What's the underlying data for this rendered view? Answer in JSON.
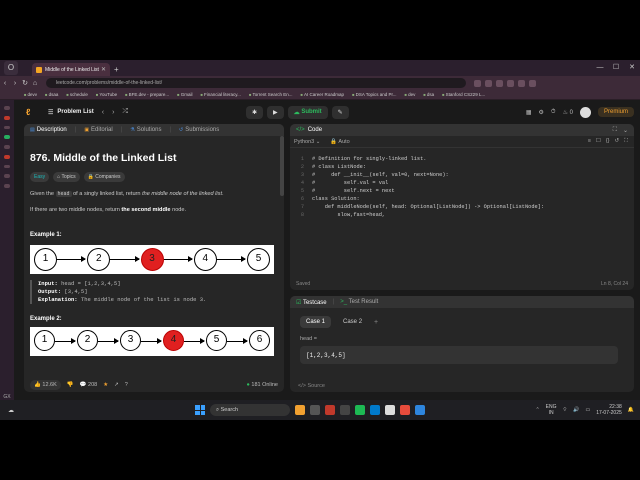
{
  "browser": {
    "tab_title": "Middle of the Linked List",
    "url": "leetcode.com/problems/middle-of-the-linked-list/",
    "bookmarks": [
      "devv",
      "dsaa",
      "schedule",
      "YouTube",
      "BFE.dev - prepare...",
      "Gmail",
      "Financial literacy...",
      "Torrent Search En...",
      "AI Career Roadmap",
      "DSA Topics and Pr...",
      "dev",
      "dsa",
      "Stanford CS229 L..."
    ]
  },
  "lc_header": {
    "problem_list": "Problem List",
    "submit": "Submit",
    "streak": "0",
    "premium": "Premium"
  },
  "problem": {
    "tabs": {
      "description": "Description",
      "editorial": "Editorial",
      "solutions": "Solutions",
      "submissions": "Submissions"
    },
    "title": "876. Middle of the Linked List",
    "difficulty": "Easy",
    "topics": "Topics",
    "companies": "Companies",
    "desc1_a": "Given the ",
    "desc1_code": "head",
    "desc1_b": " of a singly linked list, return ",
    "desc1_em": "the middle node of the linked list",
    "desc1_c": ".",
    "desc2_a": "If there are two middle nodes, return ",
    "desc2_b": "the second middle",
    "desc2_c": " node.",
    "example1": {
      "title": "Example 1:",
      "nodes": [
        "1",
        "2",
        "3",
        "4",
        "5"
      ],
      "input_label": "Input:",
      "input": "head = [1,2,3,4,5]",
      "output_label": "Output:",
      "output": "[3,4,5]",
      "explanation_label": "Explanation:",
      "explanation": "The middle node of the list is node 3."
    },
    "example2": {
      "title": "Example 2:",
      "nodes": [
        "1",
        "2",
        "3",
        "4",
        "5",
        "6"
      ]
    },
    "footer": {
      "likes": "12.6K",
      "comments": "208",
      "online": "181 Online"
    }
  },
  "code": {
    "title": "Code",
    "language": "Python3",
    "mode": "Auto",
    "lines": [
      "# Definition for singly-linked list.",
      "# class ListNode:",
      "#     def __init__(self, val=0, next=None):",
      "#         self.val = val",
      "#         self.next = next",
      "class Solution:",
      "    def middleNode(self, head: Optional[ListNode]) -> Optional[ListNode]:",
      "        slow,fast=head,"
    ],
    "status": "Saved",
    "cursor": "Ln 8, Col 24"
  },
  "testcase": {
    "tab1": "Testcase",
    "tab2": "Test Result",
    "case1": "Case 1",
    "case2": "Case 2",
    "input_label": "head =",
    "input_value": "[1,2,3,4,5]",
    "source": "Source"
  },
  "taskbar": {
    "search": "Search",
    "lang1": "ENG",
    "lang2": "IN",
    "time": "22:38",
    "date": "17-07-2025",
    "gx": "GX"
  }
}
